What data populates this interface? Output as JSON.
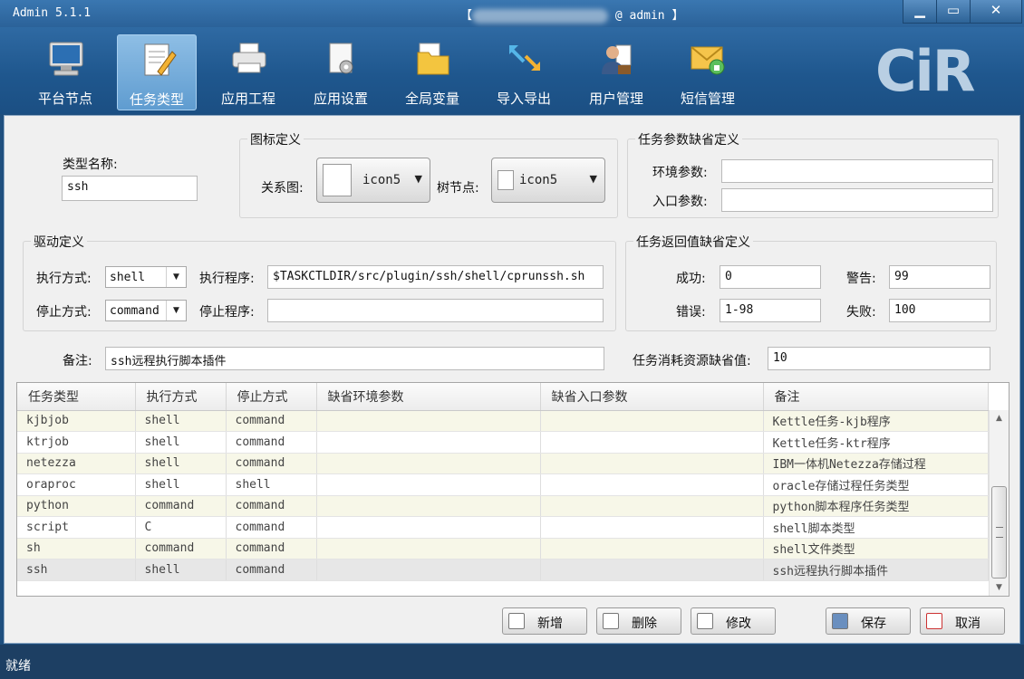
{
  "window": {
    "title": "Admin 5.1.1",
    "user_prefix": "【",
    "user_suffix": "@ admin 】",
    "minimize_glyph": "▁",
    "maximize_glyph": "▭",
    "close_glyph": "✕"
  },
  "toolbar": {
    "items": [
      {
        "label": "平台节点",
        "icon": "computer-icon"
      },
      {
        "label": "任务类型",
        "icon": "notepad-pencil-icon",
        "active": true
      },
      {
        "label": "应用工程",
        "icon": "printer-icon"
      },
      {
        "label": "应用设置",
        "icon": "document-gear-icon"
      },
      {
        "label": "全局变量",
        "icon": "folder-icon"
      },
      {
        "label": "导入导出",
        "icon": "arrows-icon"
      },
      {
        "label": "用户管理",
        "icon": "users-icon"
      },
      {
        "label": "短信管理",
        "icon": "envelope-lock-icon"
      }
    ],
    "logo_text": "CiR"
  },
  "form": {
    "type_name_label": "类型名称:",
    "type_name_value": "ssh",
    "icon_group_title": "图标定义",
    "relation_label": "关系图:",
    "relation_value": "icon5",
    "tree_label": "树节点:",
    "tree_value": "icon5",
    "param_group_title": "任务参数缺省定义",
    "env_label": "环境参数:",
    "env_value": "",
    "entry_label": "入口参数:",
    "entry_value": "",
    "driver_group_title": "驱动定义",
    "exec_mode_label": "执行方式:",
    "exec_mode_value": "shell",
    "exec_prog_label": "执行程序:",
    "exec_prog_value": "$TASKCTLDIR/src/plugin/ssh/shell/cprunssh.sh",
    "stop_mode_label": "停止方式:",
    "stop_mode_value": "command",
    "stop_prog_label": "停止程序:",
    "stop_prog_value": "",
    "return_group_title": "任务返回值缺省定义",
    "success_label": "成功:",
    "success_value": "0",
    "warning_label": "警告:",
    "warning_value": "99",
    "error_label": "错误:",
    "error_value": "1-98",
    "failure_label": "失败:",
    "failure_value": "100",
    "note_label": "备注:",
    "note_value": "ssh远程执行脚本插件",
    "resource_label": "任务消耗资源缺省值:",
    "resource_value": "10"
  },
  "grid": {
    "columns": [
      "任务类型",
      "执行方式",
      "停止方式",
      "缺省环境参数",
      "缺省入口参数",
      "备注"
    ],
    "rows": [
      [
        "kjbjob",
        "shell",
        "command",
        "",
        "",
        "Kettle任务-kjb程序"
      ],
      [
        "ktrjob",
        "shell",
        "command",
        "",
        "",
        "Kettle任务-ktr程序"
      ],
      [
        "netezza",
        "shell",
        "command",
        "",
        "",
        "IBM一体机Netezza存储过程"
      ],
      [
        "oraproc",
        "shell",
        "shell",
        "",
        "",
        "oracle存储过程任务类型"
      ],
      [
        "python",
        "command",
        "command",
        "",
        "",
        "python脚本程序任务类型"
      ],
      [
        "script",
        "C",
        "command",
        "",
        "",
        "shell脚本类型"
      ],
      [
        "sh",
        "command",
        "command",
        "",
        "",
        "shell文件类型"
      ],
      [
        "ssh",
        "shell",
        "command",
        "",
        "",
        "ssh远程执行脚本插件"
      ]
    ],
    "scroll_up_glyph": "▲",
    "scroll_down_glyph": "▼"
  },
  "buttons": {
    "add": "新增",
    "delete": "删除",
    "modify": "修改",
    "save": "保存",
    "cancel": "取消"
  },
  "status": {
    "text": "就绪"
  }
}
